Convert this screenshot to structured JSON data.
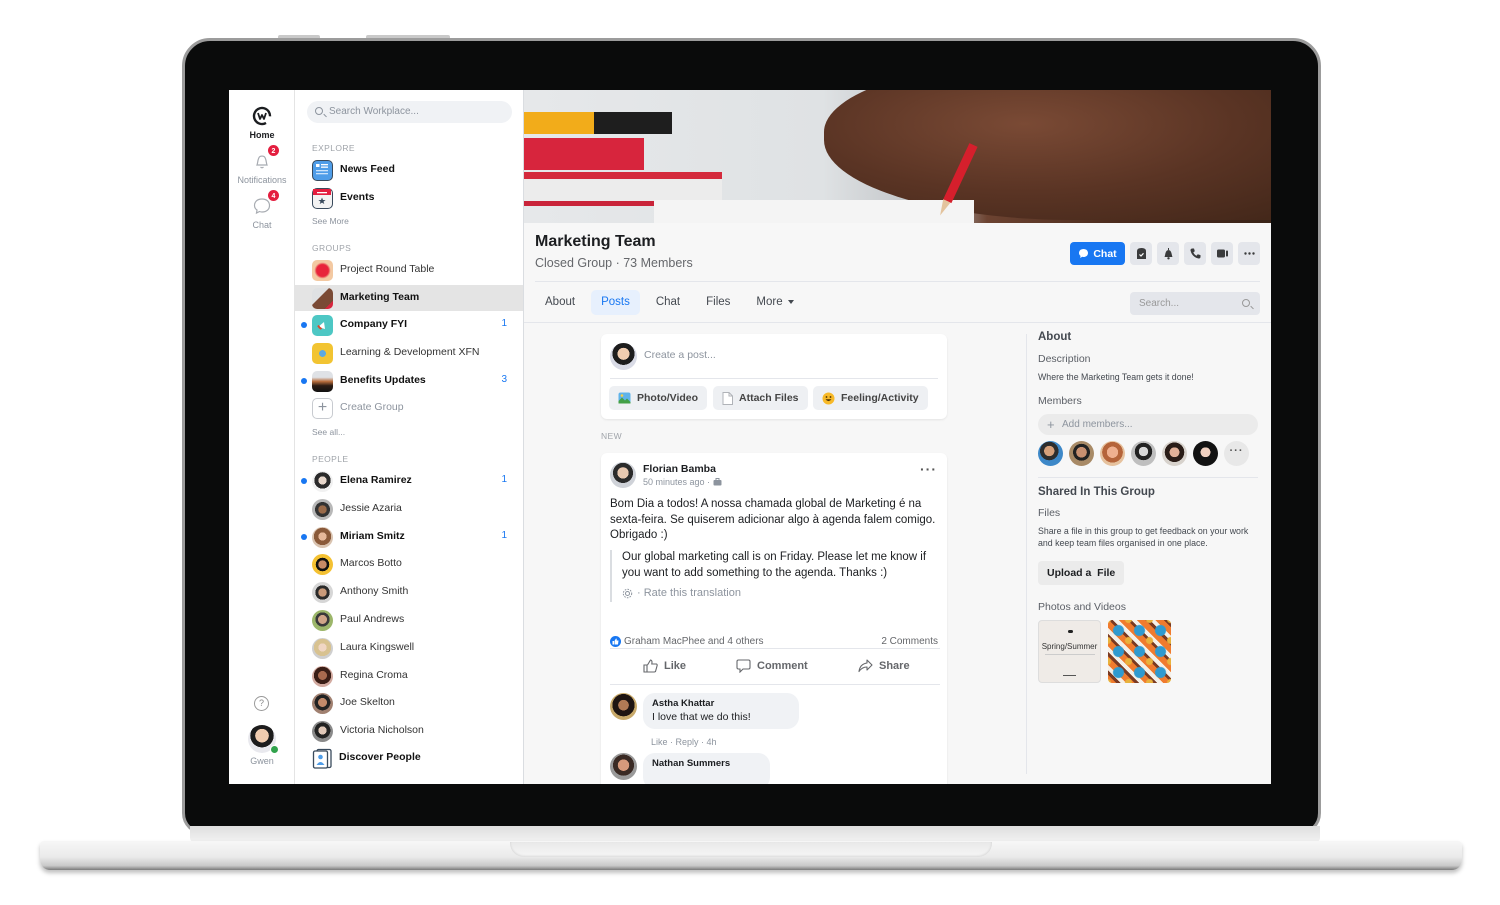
{
  "rail": {
    "home_label": "Home",
    "notifications_label": "Notifications",
    "notifications_badge": "2",
    "chat_label": "Chat",
    "chat_badge": "4",
    "help_icon_glyph": "?",
    "user_name": "Gwen"
  },
  "nav": {
    "search_placeholder": "Search Workplace...",
    "explore_header": "EXPLORE",
    "explore_items": [
      {
        "label": "News Feed",
        "icon": "news-feed-icon"
      },
      {
        "label": "Events",
        "icon": "events-icon"
      }
    ],
    "explore_see_more": "See More",
    "groups_header": "GROUPS",
    "groups": [
      {
        "label": "Project Round Table",
        "unread": false,
        "count": ""
      },
      {
        "label": "Marketing Team",
        "unread": false,
        "count": "",
        "selected": true
      },
      {
        "label": "Company FYI",
        "unread": true,
        "count": "1"
      },
      {
        "label": "Learning & Development XFN",
        "unread": false,
        "count": ""
      },
      {
        "label": "Benefits Updates",
        "unread": true,
        "count": "3"
      }
    ],
    "create_group": "Create Group",
    "groups_see_all": "See all...",
    "people_header": "PEOPLE",
    "people": [
      {
        "name": "Elena Ramirez",
        "unread": true,
        "count": "1"
      },
      {
        "name": "Jessie Azaria",
        "unread": false,
        "count": ""
      },
      {
        "name": "Miriam Smitz",
        "unread": true,
        "count": "1"
      },
      {
        "name": "Marcos Botto",
        "unread": false,
        "count": ""
      },
      {
        "name": "Anthony Smith",
        "unread": false,
        "count": ""
      },
      {
        "name": "Paul Andrews",
        "unread": false,
        "count": ""
      },
      {
        "name": "Laura Kingswell",
        "unread": false,
        "count": ""
      },
      {
        "name": "Regina Croma",
        "unread": false,
        "count": ""
      },
      {
        "name": "Joe Skelton",
        "unread": false,
        "count": ""
      },
      {
        "name": "Victoria Nicholson",
        "unread": false,
        "count": ""
      }
    ],
    "discover_people": "Discover People"
  },
  "group": {
    "title": "Marketing Team",
    "subtitle": "Closed Group · 73 Members",
    "chat_button": "Chat",
    "tabs": [
      "About",
      "Posts",
      "Chat",
      "Files",
      "More"
    ],
    "active_tab": "Posts",
    "search_placeholder": "Search..."
  },
  "composer": {
    "placeholder": "Create a post...",
    "photo_video": "Photo/Video",
    "attach_files": "Attach Files",
    "feeling_activity": "Feeling/Activity"
  },
  "feed": {
    "new_label": "NEW",
    "post": {
      "author": "Florian Bamba",
      "time": "50 minutes ago ·",
      "body": "Bom Dia a todos! A nossa chamada global de Marketing é na sexta-feira. Se quiserem adicionar algo à agenda falem comigo. Obrigado :)",
      "translation": "Our global marketing call is on Friday. Please let me know if you want to add something to the agenda. Thanks :)",
      "rate_translation": "· Rate this translation",
      "likes_text": "Graham MacPhee and 4 others",
      "comments_count": "2 Comments",
      "like_action": "Like",
      "comment_action": "Comment",
      "share_action": "Share",
      "comments": [
        {
          "author": "Astha Khattar",
          "text": "I love that we do this!",
          "like": "Like",
          "reply": "Reply",
          "time": "4h"
        },
        {
          "author": "Nathan Summers",
          "text": ""
        }
      ]
    }
  },
  "about": {
    "header": "About",
    "description_label": "Description",
    "description": "Where the Marketing Team gets it done!",
    "members_label": "Members",
    "add_members_placeholder": "Add members...",
    "more_members": "···",
    "shared_header": "Shared In This Group",
    "files_label": "Files",
    "files_text": "Share a file in this group to get feedback on your work and keep team files organised in one place.",
    "upload_button": "Upload a  File",
    "photos_label": "Photos and Videos",
    "photo1_caption": "Spring/Summer"
  },
  "colors": {
    "accent": "#1877f2",
    "badge": "#e41e3f",
    "online": "#31a24c"
  }
}
